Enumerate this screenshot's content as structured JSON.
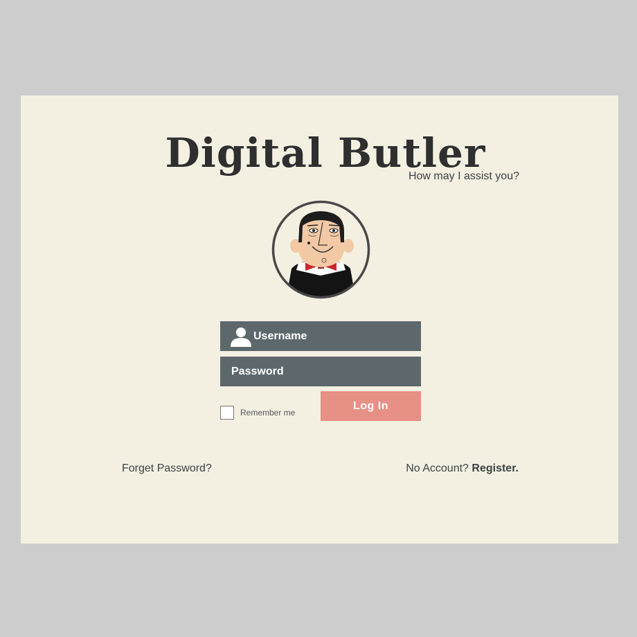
{
  "brand": {
    "title": "Digital Butler",
    "tagline": "How may I assist you?"
  },
  "avatar": {
    "icon": "butler-avatar"
  },
  "form": {
    "username_placeholder": "Username",
    "username_value": "",
    "password_placeholder": "Password",
    "password_value": "",
    "remember_label": "Remember me",
    "remember_checked": false,
    "login_label": "Log In"
  },
  "footer": {
    "forgot_label": "Forget Password?",
    "no_account_label": "No Account?",
    "register_label": "Register."
  },
  "colors": {
    "background": "#cdcdcd",
    "card": "#f3f0e2",
    "field": "#5d686d",
    "button": "#e69086",
    "text": "#3c4244"
  }
}
